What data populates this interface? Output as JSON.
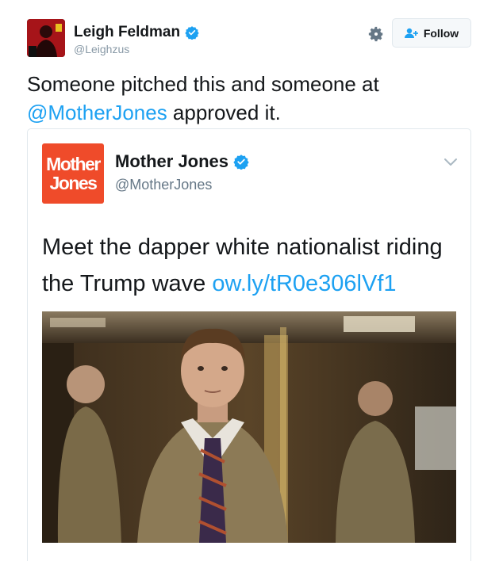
{
  "tweet": {
    "author": {
      "display_name": "Leigh Feldman",
      "handle": "@Leighzus",
      "verified": true
    },
    "follow_label": "Follow",
    "text_parts": {
      "line_start": "Someone pitched this and someone at ",
      "mention": "@MotherJones",
      "line_end": " approved it."
    }
  },
  "quoted": {
    "logo_lines": [
      "Mother",
      "Jones"
    ],
    "display_name": "Mother Jones",
    "handle": "@MotherJones",
    "verified": true,
    "text": "Meet the dapper white nationalist riding the Trump wave ",
    "link": "ow.ly/tR0e306lVf1",
    "image": "man-in-tweed-jacket-elevator-photo"
  },
  "colors": {
    "link": "#1da1f2",
    "verified": "#1da1f2",
    "logo_bg": "#ef4b2a",
    "handle": "#8899a6"
  },
  "icons": [
    "settings-gear-icon",
    "follow-person-plus-icon",
    "verified-badge-icon",
    "chevron-down-icon"
  ]
}
